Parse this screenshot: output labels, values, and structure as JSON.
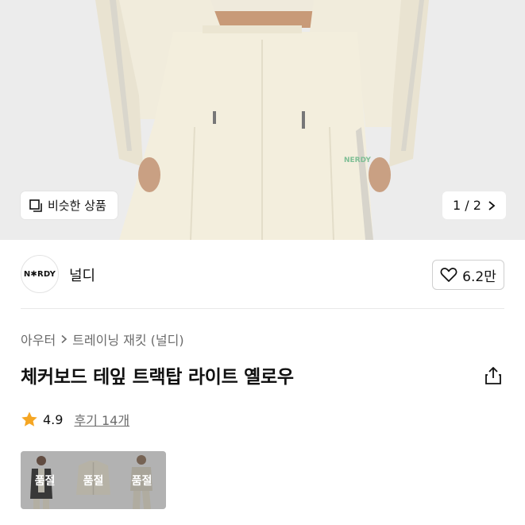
{
  "hero": {
    "similar_label": "비슷한 상품",
    "similar_icon": "similar-items-icon",
    "page_indicator": "1 / 2",
    "next_icon": "chevron-right-icon",
    "print_text": "NERDY"
  },
  "brand": {
    "logo_text": "N✱RDY",
    "name": "널디",
    "like_icon": "heart-outline-icon",
    "like_count": "6.2만"
  },
  "breadcrumb": {
    "items": [
      "아우터",
      "트레이닝 재킷 (널디)"
    ],
    "separator_icon": "chevron-right-icon"
  },
  "product": {
    "title": "체커보드 테잎 트랙탑 라이트 옐로우",
    "share_icon": "share-icon"
  },
  "rating": {
    "star_icon": "star-icon",
    "star_color": "#f5a623",
    "score": "4.9",
    "reviews": "후기 14개"
  },
  "options": [
    {
      "label": "품절"
    },
    {
      "label": "품절"
    },
    {
      "label": "품절"
    }
  ]
}
